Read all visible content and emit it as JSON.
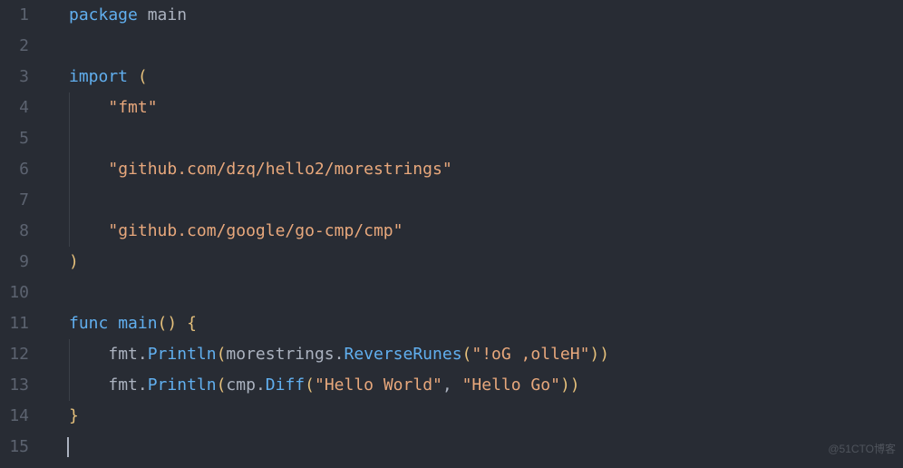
{
  "lines": {
    "n1": "1",
    "n2": "2",
    "n3": "3",
    "n4": "4",
    "n5": "5",
    "n6": "6",
    "n7": "7",
    "n8": "8",
    "n9": "9",
    "n10": "10",
    "n11": "11",
    "n12": "12",
    "n13": "13",
    "n14": "14",
    "n15": "15"
  },
  "code": {
    "kw_package": "package",
    "main_ident": " main",
    "kw_import": "import",
    "open_paren": " (",
    "str_fmt": "\"fmt\"",
    "str_morestrings": "\"github.com/dzq/hello2/morestrings\"",
    "str_cmp": "\"github.com/google/go-cmp/cmp\"",
    "close_paren": ")",
    "kw_func": "func",
    "main_fn": " main",
    "fn_parens": "()",
    "open_brace": " {",
    "l12_fmt": "fmt",
    "l12_dot1": ".",
    "l12_println": "Println",
    "l12_open": "(",
    "l12_more": "morestrings",
    "l12_dot2": ".",
    "l12_rev": "ReverseRunes",
    "l12_open2": "(",
    "l12_str": "\"!oG ,olleH\"",
    "l12_close": "))",
    "l13_fmt": "fmt",
    "l13_dot1": ".",
    "l13_println": "Println",
    "l13_open": "(",
    "l13_cmp": "cmp",
    "l13_dot2": ".",
    "l13_diff": "Diff",
    "l13_open2": "(",
    "l13_str1": "\"Hello World\"",
    "l13_comma": ", ",
    "l13_str2": "\"Hello Go\"",
    "l13_close": "))",
    "close_brace": "}"
  },
  "watermark": "@51CTO博客"
}
